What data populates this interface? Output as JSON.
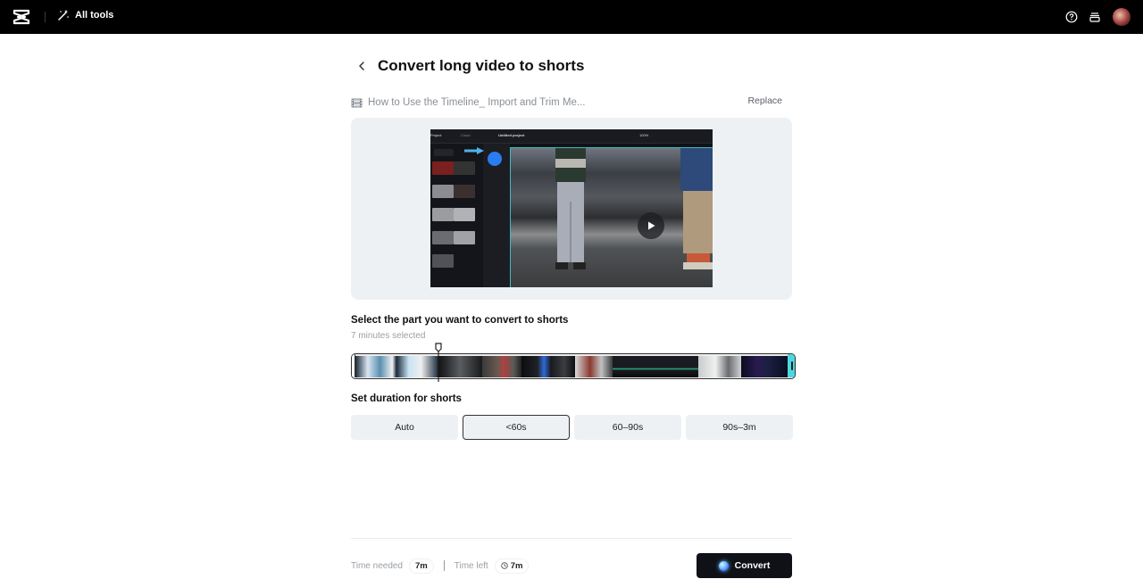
{
  "topbar": {
    "logo": "capcut-logo",
    "all_tools_label": "All tools",
    "icons": [
      "help-icon",
      "inbox-icon",
      "avatar"
    ]
  },
  "page": {
    "title": "Convert long video to shorts",
    "file_name": "How to Use the Timeline_ Import and Trim Me...",
    "replace_label": "Replace"
  },
  "preview": {
    "editor_tabs": [
      "Project",
      "Cloud"
    ],
    "editor_project_title": "Untitled project",
    "editor_zoom": "100%"
  },
  "selection": {
    "title": "Select the part you want to convert to shorts",
    "selected_text": "7 minutes selected"
  },
  "duration": {
    "title": "Set duration for shorts",
    "options": [
      {
        "label": "Auto",
        "selected": false
      },
      {
        "label": "<60s",
        "selected": true
      },
      {
        "label": "60–90s",
        "selected": false
      },
      {
        "label": "90s–3m",
        "selected": false
      }
    ]
  },
  "footer": {
    "time_needed_label": "Time needed",
    "time_needed_value": "7m",
    "time_left_label": "Time left",
    "time_left_value": "7m",
    "convert_label": "Convert"
  },
  "colors": {
    "topbar_bg": "#000000",
    "accent_cyan": "#4dd8e0",
    "convert_bg": "#0f1117",
    "option_bg": "#eef1f4"
  }
}
